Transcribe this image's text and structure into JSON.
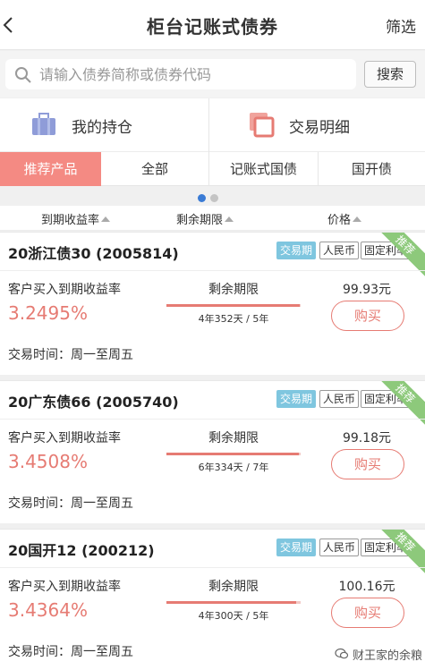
{
  "nav": {
    "title": "柜台记账式债券",
    "filter_label": "筛选"
  },
  "search": {
    "placeholder": "请输入债券简称或债券代码",
    "button_label": "搜索"
  },
  "quick": {
    "holdings_label": "我的持仓",
    "details_label": "交易明细"
  },
  "tabs": [
    {
      "label": "推荐产品",
      "active": true
    },
    {
      "label": "全部",
      "active": false
    },
    {
      "label": "记账式国债",
      "active": false
    },
    {
      "label": "国开债",
      "active": false
    }
  ],
  "pager": {
    "active_page": 1,
    "page_count": 2
  },
  "sort": {
    "yield_label": "到期收益率",
    "term_label": "剩余期限",
    "price_label": "价格"
  },
  "colors": {
    "accent": "#e67b73",
    "tab_active": "#f48a83",
    "tag_blue": "#7fc6df",
    "ribbon": "#8dc97b",
    "dot_active": "#3a7bd5",
    "dot_inactive": "#c4c4c4"
  },
  "bonds": [
    {
      "name": "20浙江债30 (2005814)",
      "tags": [
        "交易期",
        "人民币",
        "固定利率"
      ],
      "ribbon": "推荐",
      "yield_label": "客户买入到期收益率",
      "yield": "3.2495%",
      "term_label": "剩余期限",
      "term_progress": 0.993,
      "term_text": "4年352天 / 5年",
      "price": "99.93元",
      "buy_label": "购买",
      "trade_time": "交易时间：周一至周五"
    },
    {
      "name": "20广东债66 (2005740)",
      "tags": [
        "交易期",
        "人民币",
        "固定利率"
      ],
      "ribbon": "推荐",
      "yield_label": "客户买入到期收益率",
      "yield": "3.4508%",
      "term_label": "剩余期限",
      "term_progress": 0.988,
      "term_text": "6年334天 / 7年",
      "price": "99.18元",
      "buy_label": "购买",
      "trade_time": "交易时间：周一至周五"
    },
    {
      "name": "20国开12 (200212)",
      "tags": [
        "交易期",
        "人民币",
        "固定利率"
      ],
      "ribbon": "推荐",
      "yield_label": "客户买入到期收益率",
      "yield": "3.4364%",
      "term_label": "剩余期限",
      "term_progress": 0.964,
      "term_text": "4年300天 / 5年",
      "price": "100.16元",
      "buy_label": "购买",
      "trade_time": "交易时间：周一至周五"
    }
  ],
  "watermark": {
    "text": "财王家的余粮"
  }
}
